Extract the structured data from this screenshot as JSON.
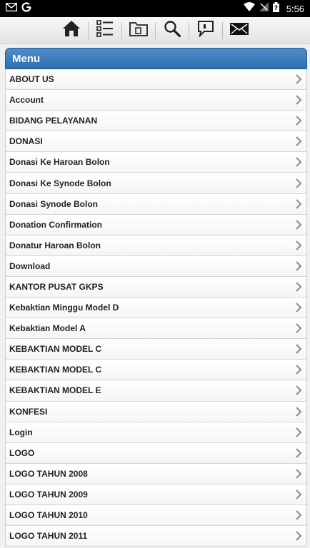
{
  "status_bar": {
    "time": "5:56",
    "left_icons": [
      "gmail-icon",
      "google-icon"
    ],
    "right_icons": [
      "wifi-icon",
      "no-sim-icon",
      "battery-icon"
    ]
  },
  "toolbar": {
    "buttons": [
      "home-icon",
      "list-icon",
      "folder-icon",
      "search-icon",
      "message-icon",
      "mail-icon"
    ]
  },
  "menu": {
    "title": "Menu",
    "items": [
      "ABOUT US",
      "Account",
      "BIDANG PELAYANAN",
      "DONASI",
      "Donasi Ke Haroan Bolon",
      "Donasi Ke Synode Bolon",
      "Donasi Synode Bolon",
      "Donation Confirmation",
      "Donatur Haroan Bolon",
      "Download",
      "KANTOR PUSAT GKPS",
      "Kebaktian Minggu Model D",
      "Kebaktian Model A",
      "KEBAKTIAN MODEL C",
      "KEBAKTIAN MODEL C",
      "KEBAKTIAN MODEL E",
      "KONFESI",
      "Login",
      "LOGO",
      "LOGO TAHUN 2008",
      "LOGO TAHUN 2009",
      "LOGO TAHUN 2010",
      "LOGO TAHUN 2011"
    ]
  }
}
